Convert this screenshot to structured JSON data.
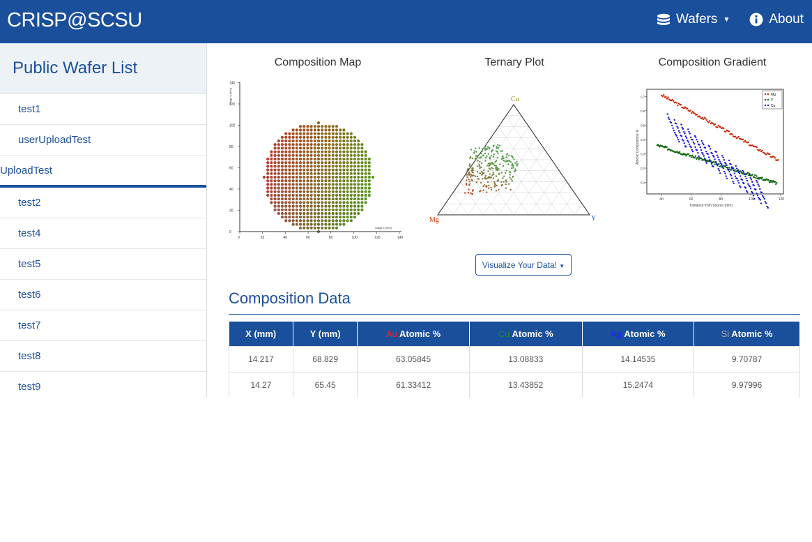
{
  "app": {
    "brand": "CRISP@SCSU"
  },
  "nav": {
    "wafers_label": "Wafers",
    "about_label": "About",
    "wafers_icon": "database-icon",
    "about_icon": "info-circle-icon"
  },
  "sidebar": {
    "title": "Public Wafer List",
    "items": [
      {
        "label": "test1"
      },
      {
        "label": "userUploadTest"
      },
      {
        "label": "UploadTest",
        "active": true
      },
      {
        "label": "test2"
      },
      {
        "label": "test4"
      },
      {
        "label": "test5"
      },
      {
        "label": "test6"
      },
      {
        "label": "test7"
      },
      {
        "label": "test8"
      },
      {
        "label": "test9"
      }
    ]
  },
  "plots": {
    "composition_map_title": "Composition Map",
    "ternary_title": "Ternary Plot",
    "gradient_title": "Composition Gradient",
    "map_ylabel": "Stage y (mm)",
    "map_xlabel": "Stage x (mm)",
    "map_xticks": [
      "0",
      "20",
      "40",
      "60",
      "80",
      "100",
      "120",
      "140"
    ],
    "map_yticks": [
      "0",
      "20",
      "40",
      "60",
      "80",
      "100",
      "120",
      "140"
    ],
    "ternary_top": "Cu",
    "ternary_left": "Mg",
    "ternary_right": "Y",
    "grad_xlabel": "Distance from Source (mm)",
    "grad_ylabel": "Atomic Composition %",
    "grad_xticks": [
      "40",
      "60",
      "80",
      "100",
      "120"
    ],
    "grad_yticks": [
      "0.1",
      "0.2",
      "0.3",
      "0.4",
      "0.5",
      "0.6",
      "0.7"
    ],
    "grad_legend": [
      "Mg",
      "Y",
      "Cu"
    ]
  },
  "colors": {
    "brand_blue": "#1a4f9c",
    "au": "#ff2020",
    "cu": "#1a8a1a",
    "ag": "#2020ff",
    "si": "#aaaaaa",
    "mg_series": "#cc2200",
    "y_series": "#116611",
    "cu_series": "#1111dd"
  },
  "visualize_button": "Visualize Your Data!",
  "section_title": "Composition Data",
  "table": {
    "headers": [
      {
        "prefix": "",
        "label": "X (mm)"
      },
      {
        "prefix": "",
        "label": "Y (mm)"
      },
      {
        "prefix": "Au",
        "label": " Atomic %"
      },
      {
        "prefix": "Cu",
        "label": " Atomic %"
      },
      {
        "prefix": "Ag",
        "label": " Atomic %"
      },
      {
        "prefix": "Si",
        "label": " Atomic %"
      }
    ],
    "rows": [
      [
        "14.217",
        "68.829",
        "63.05845",
        "13.08833",
        "14.14535",
        "9.70787"
      ],
      [
        "14.27",
        "65.45",
        "61.33412",
        "13.43852",
        "15.2474",
        "9.97996"
      ]
    ]
  }
}
